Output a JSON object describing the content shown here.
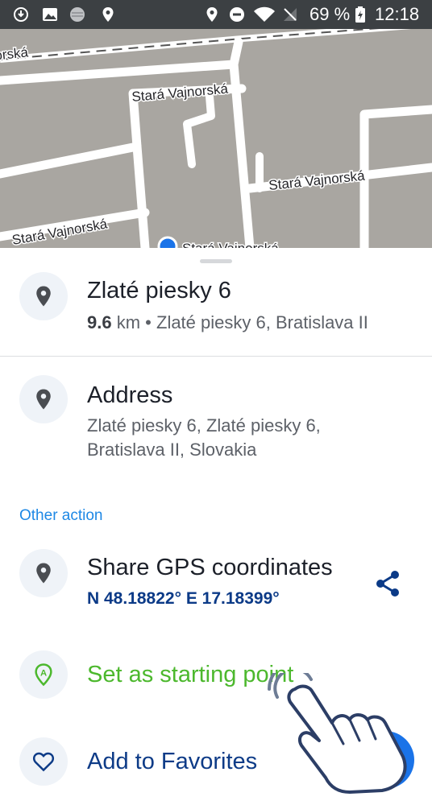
{
  "status_bar": {
    "battery": "69 %",
    "time": "12:18"
  },
  "map": {
    "streets": [
      "Stará Vajnorská",
      "Stará Vajnorská",
      "Stará Vajnorská"
    ],
    "partial_label_left": "orská",
    "partial_label_bottom": "Stará Vajnorská"
  },
  "place": {
    "title": "Zlaté piesky 6",
    "distance_value": "9.6",
    "distance_unit": "km",
    "separator": "•",
    "locality": "Zlaté piesky 6, Bratislava II"
  },
  "address": {
    "heading": "Address",
    "line1": "Zlaté piesky 6, Zlaté piesky 6,",
    "line2": "Bratislava II, Slovakia"
  },
  "other_action": {
    "label": "Other action"
  },
  "share": {
    "title": "Share GPS coordinates",
    "coordinates": "N 48.18822° E 17.18399°"
  },
  "start_point": {
    "label": "Set as starting point",
    "icon_letter": "A"
  },
  "favorites": {
    "label": "Add to Favorites"
  },
  "colors": {
    "accent_blue": "#1e88e5",
    "coord_navy": "#0b3a87",
    "green": "#4cb82d"
  }
}
